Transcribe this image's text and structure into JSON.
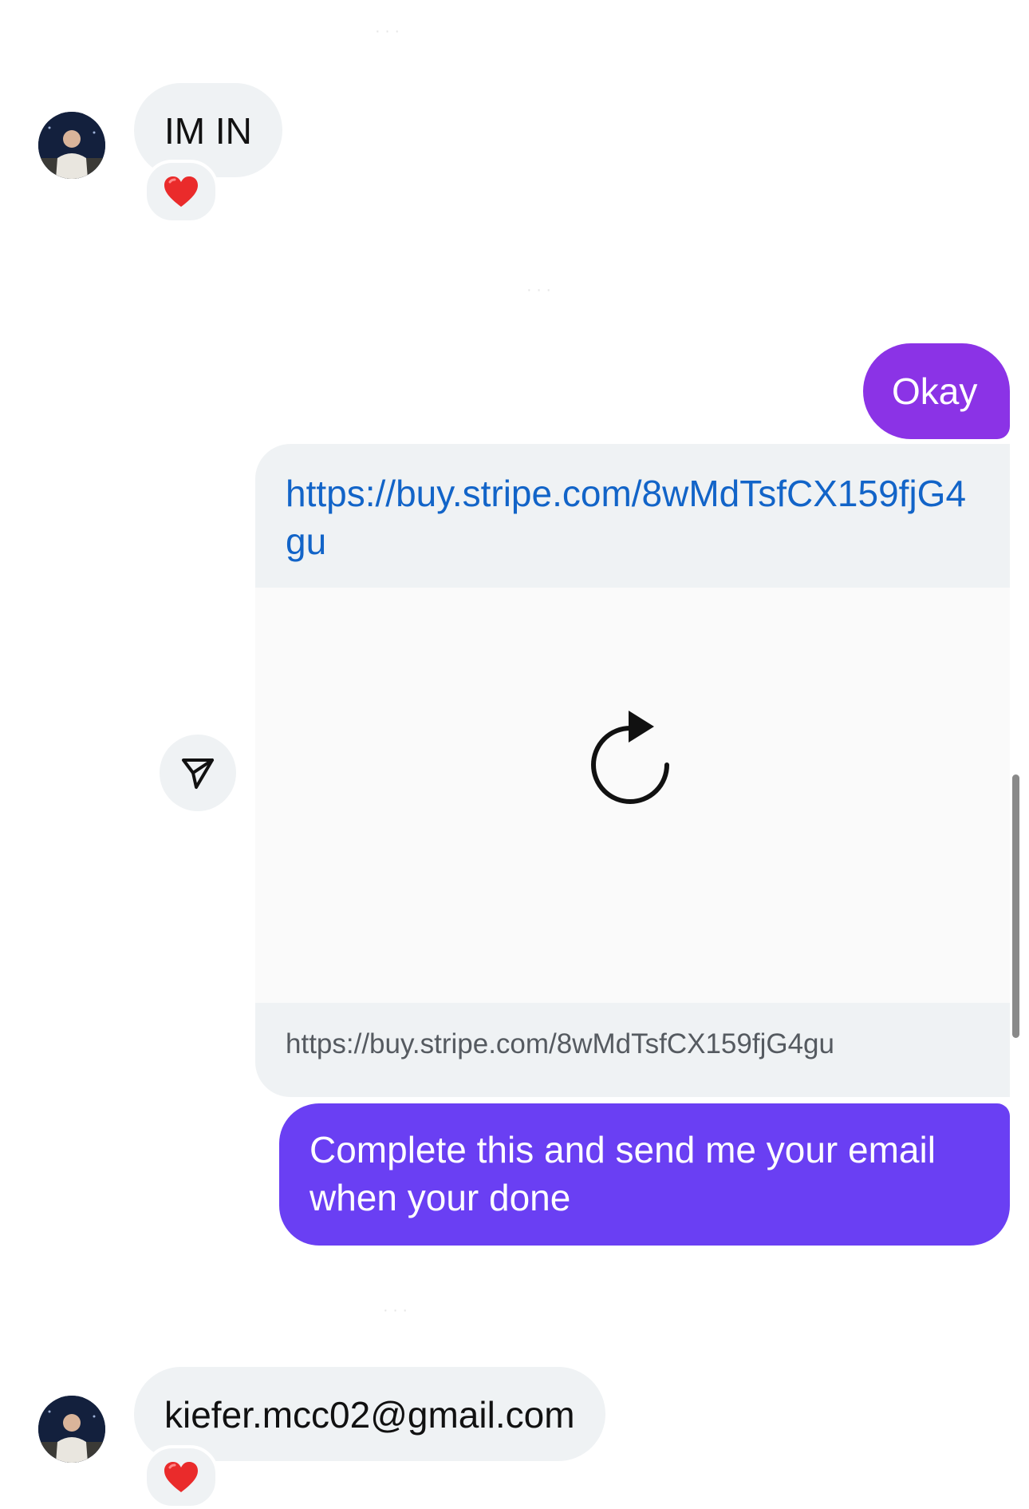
{
  "messages": {
    "m1": {
      "text": "IM IN",
      "reaction": "❤️"
    },
    "m2": {
      "text": "Okay"
    },
    "m3": {
      "link_text": "https://buy.stripe.com/8wMdTsfCX159fjG4gu",
      "preview_url": "https://buy.stripe.com/8wMdTsfCX159fjG4gu"
    },
    "m4": {
      "text": "Complete this and send me your email when your done"
    },
    "m5": {
      "text": "kiefer.mcc02@gmail.com",
      "reaction": "❤️"
    }
  },
  "colors": {
    "incoming_bubble": "#eff2f4",
    "outgoing_okay": "#8b33e6",
    "outgoing_complete": "#6a3ff3",
    "link": "#1264c8"
  },
  "icons": {
    "share": "send-paper-plane-icon",
    "reload": "reload-icon",
    "reaction": "heart-emoji"
  }
}
